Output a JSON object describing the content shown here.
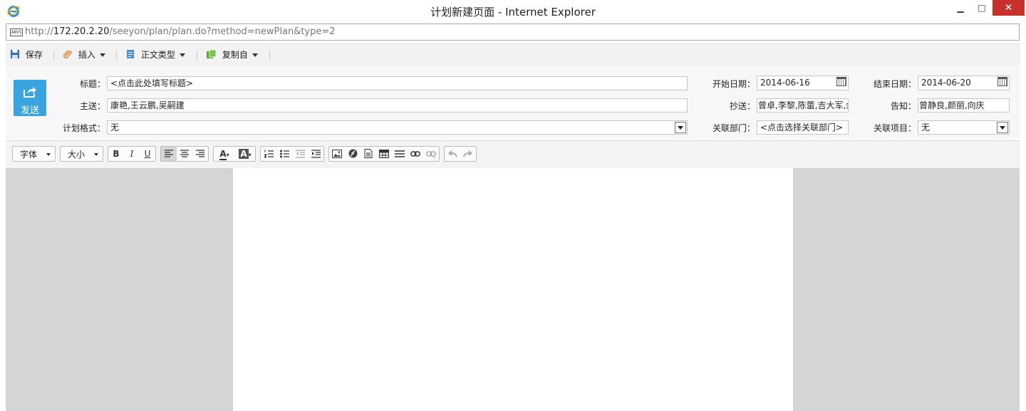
{
  "window": {
    "title": "计划新建页面 - Internet Explorer",
    "minimize": "▁",
    "maximize": "□",
    "close": "✕"
  },
  "address": {
    "icon_text": "ABVS",
    "prefix": "http://",
    "host": "172.20.2.20",
    "path": "/seeyon/plan/plan.do?method=newPlan&type=2"
  },
  "toolbar": {
    "save": "保存",
    "insert": "插入",
    "body_type": "正文类型",
    "copy_from": "复制自"
  },
  "form": {
    "send": "发送",
    "title_label": "标题：",
    "title_value": "<点击此处填写标题>",
    "to_label": "主送：",
    "to_value": "康艳,王云鹏,吴嗣建",
    "format_label": "计划格式：",
    "format_value": "无",
    "start_label": "开始日期：",
    "start_value": "2014-06-16",
    "cc_label": "抄送：",
    "cc_value": "曾卓,李黎,陈蕾,吉大军,余",
    "dept_label": "关联部门：",
    "dept_value": "<点击选择关联部门>",
    "end_label": "结束日期：",
    "end_value": "2014-06-20",
    "notify_label": "告知：",
    "notify_value": "曾静良,颜丽,向庆",
    "project_label": "关联项目：",
    "project_value": "无"
  },
  "editor": {
    "font": "字体",
    "size": "大小",
    "bold": "B",
    "italic": "I",
    "underline": "U",
    "font_color": "A",
    "bg_color": "A"
  },
  "colors": {
    "send_button": "#3aa4e0",
    "close_button": "#c7302b",
    "editor_bg": "#d5d5d5"
  }
}
